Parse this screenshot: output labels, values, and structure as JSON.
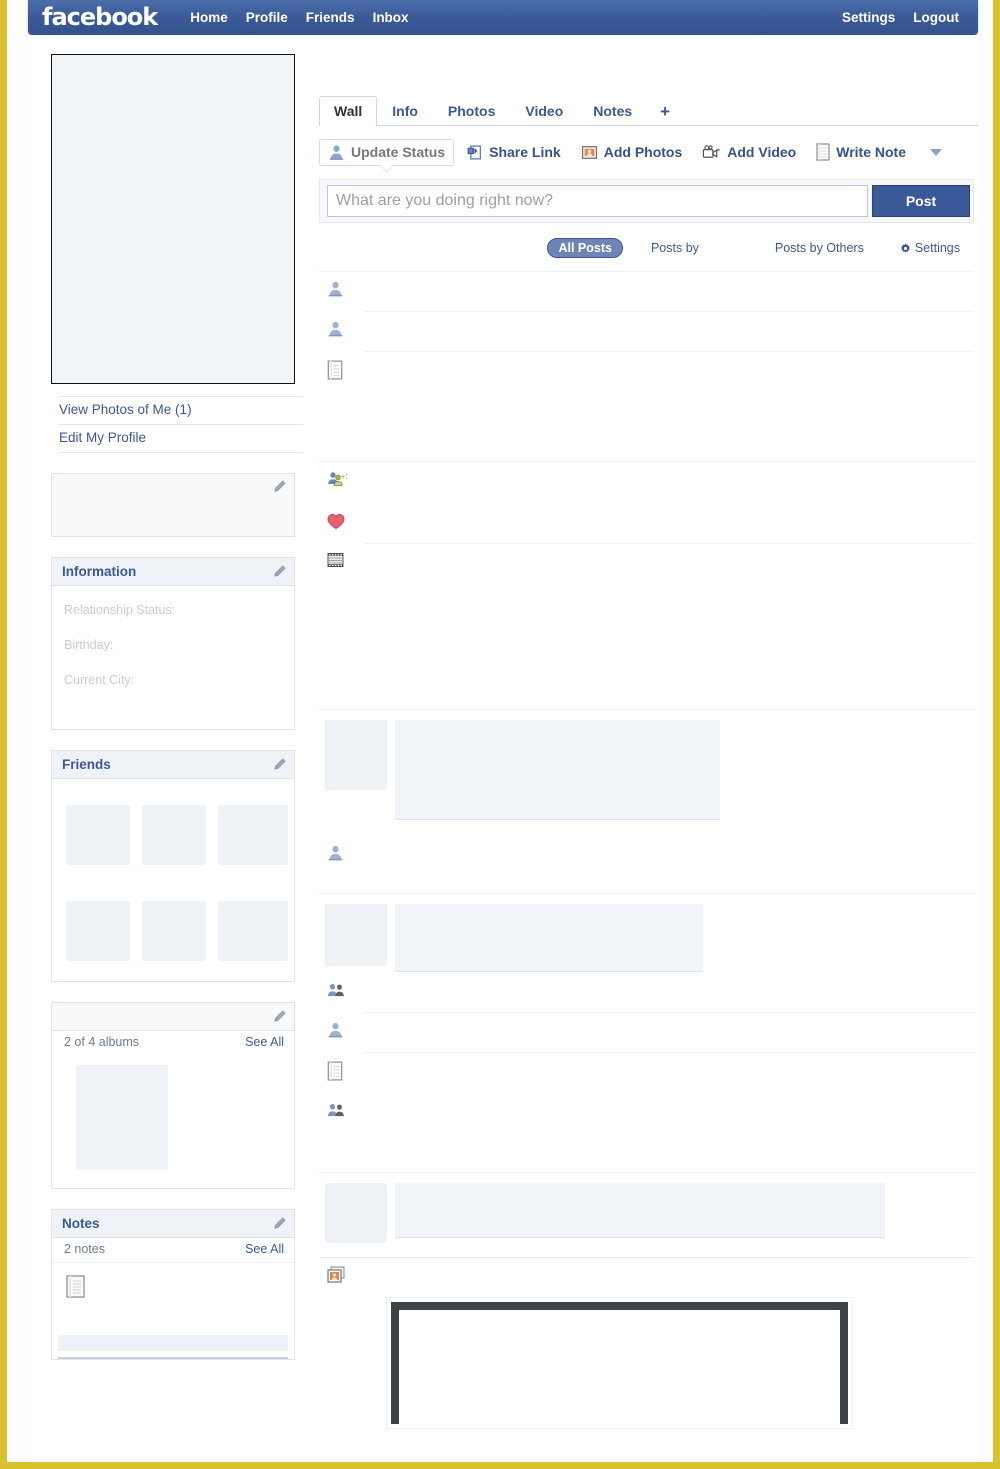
{
  "brand": {
    "logo_text": "facebook",
    "accent": "#3b5998",
    "frame_color": "#d9c22e"
  },
  "topbar": {
    "nav": [
      {
        "label": "Home",
        "name": "nav-home"
      },
      {
        "label": "Profile",
        "name": "nav-profile"
      },
      {
        "label": "Friends",
        "name": "nav-friends"
      },
      {
        "label": "Inbox",
        "name": "nav-inbox"
      }
    ],
    "right": [
      {
        "label": "Settings",
        "name": "nav-settings"
      },
      {
        "label": "Logout",
        "name": "nav-logout"
      }
    ]
  },
  "sidebar": {
    "profile_links": [
      {
        "label": "View Photos of Me (1)"
      },
      {
        "label": "Edit My Profile"
      }
    ],
    "blank_box": {
      "title": ""
    },
    "information": {
      "title": "Information",
      "rows": [
        {
          "label": "Relationship Status:"
        },
        {
          "label": "Birthday:"
        },
        {
          "label": "Current City:"
        }
      ]
    },
    "friends": {
      "title": "Friends",
      "thumb_count": 6
    },
    "photos": {
      "title": "",
      "count_text": "2 of 4 albums",
      "see_all": "See All"
    },
    "notes": {
      "title": "Notes",
      "count_text": "2 notes",
      "see_all": "See All"
    }
  },
  "main": {
    "tabs": [
      {
        "label": "Wall",
        "active": true
      },
      {
        "label": "Info",
        "active": false
      },
      {
        "label": "Photos",
        "active": false
      },
      {
        "label": "Video",
        "active": false
      },
      {
        "label": "Notes",
        "active": false
      },
      {
        "label": "+",
        "active": false
      }
    ],
    "tools": [
      {
        "label": "Update Status",
        "icon": "person-icon",
        "selected": true
      },
      {
        "label": "Share Link",
        "icon": "link-icon",
        "selected": false
      },
      {
        "label": "Add Photos",
        "icon": "photo-icon",
        "selected": false
      },
      {
        "label": "Add Video",
        "icon": "video-icon",
        "selected": false
      },
      {
        "label": "Write Note",
        "icon": "note-icon",
        "selected": false
      }
    ],
    "composer": {
      "placeholder": "What are you doing right now?",
      "value": "",
      "post_label": "Post"
    },
    "filters": [
      {
        "label": "All Posts",
        "active": true
      },
      {
        "label": "Posts by",
        "active": false
      },
      {
        "label": "Posts by Others",
        "active": false
      },
      {
        "label": "Settings",
        "active": false,
        "icon": "gear-icon"
      }
    ],
    "feed": [
      {
        "icon": "person-icon"
      },
      {
        "icon": "person-icon"
      },
      {
        "icon": "note-icon"
      },
      {
        "icon": "friend-add-icon"
      },
      {
        "icon": "heart-icon"
      },
      {
        "icon": "film-icon"
      },
      {
        "icon": "person-icon"
      },
      {
        "icon": "two-people-icon"
      },
      {
        "icon": "person-icon"
      },
      {
        "icon": "note-icon"
      },
      {
        "icon": "two-people-icon"
      },
      {
        "icon": "photo-album-icon"
      }
    ]
  }
}
